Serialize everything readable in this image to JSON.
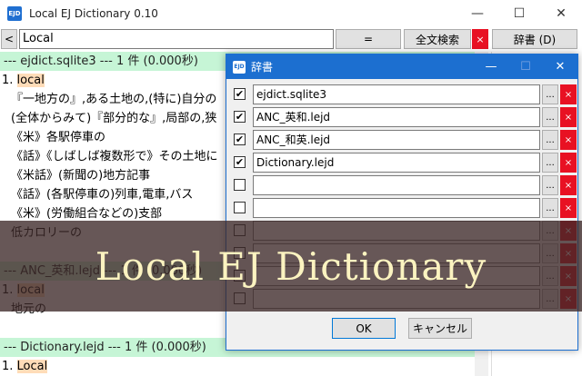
{
  "window": {
    "title": "Local EJ Dictionary 0.10",
    "icon": "dictionary-app-icon",
    "minimize": "—",
    "maximize": "☐",
    "close": "✕"
  },
  "toolbar": {
    "back_label": "<",
    "search_value": "Local",
    "equals_label": "=",
    "fulltext_label": "全文検索",
    "clear_label": "×",
    "dict_label": "辞書 (D)"
  },
  "results": [
    {
      "kind": "sep",
      "text": "--- ejdict.sqlite3 ---  1 件 (0.000秒)"
    },
    {
      "kind": "head",
      "num": "1. ",
      "word": "local"
    },
    {
      "kind": "def",
      "text": "『一地方の』,ある土地の,(特に)自分の"
    },
    {
      "kind": "def",
      "text": "(全体からみて)『部分的な』,局部の,狭"
    },
    {
      "kind": "def",
      "text": "《米》各駅停車の"
    },
    {
      "kind": "def",
      "text": "《話》《しばしば複数形で》その土地に"
    },
    {
      "kind": "def",
      "text": "《米話》(新聞の)地方記事"
    },
    {
      "kind": "def",
      "text": "《話》(各駅停車の)列車,電車,バス"
    },
    {
      "kind": "def",
      "text": "《米》(労働組合などの)支部"
    },
    {
      "kind": "def",
      "text": "低カロリーの"
    },
    {
      "kind": "blank",
      "text": ""
    },
    {
      "kind": "sep",
      "text": "--- ANC_英和.lejd ---  1 件 (0.000秒)"
    },
    {
      "kind": "head",
      "num": "1. ",
      "word": "local"
    },
    {
      "kind": "def",
      "text": "地元の"
    },
    {
      "kind": "blank",
      "text": ""
    },
    {
      "kind": "sep",
      "text": "--- Dictionary.lejd ---  1 件 (0.000秒)"
    },
    {
      "kind": "head",
      "num": "1. ",
      "word": "Local"
    }
  ],
  "dialog": {
    "title": "辞書",
    "minimize": "—",
    "maximize": "☐",
    "close": "✕",
    "rows": [
      {
        "checked": true,
        "name": "ejdict.sqlite3"
      },
      {
        "checked": true,
        "name": "ANC_英和.lejd"
      },
      {
        "checked": true,
        "name": "ANC_和英.lejd"
      },
      {
        "checked": true,
        "name": "Dictionary.lejd"
      },
      {
        "checked": false,
        "name": ""
      },
      {
        "checked": false,
        "name": ""
      },
      {
        "checked": false,
        "name": ""
      },
      {
        "checked": false,
        "name": ""
      },
      {
        "checked": false,
        "name": ""
      },
      {
        "checked": false,
        "name": ""
      }
    ],
    "browse_label": "...",
    "delete_label": "×",
    "check_mark": "✔",
    "ok_label": "OK",
    "cancel_label": "キャンセル"
  },
  "banner": {
    "text": "Local EJ Dictionary"
  }
}
